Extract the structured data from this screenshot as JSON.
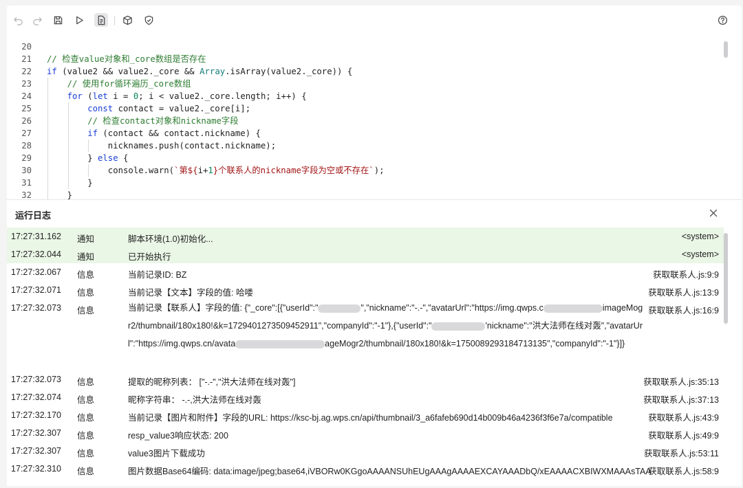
{
  "toolbar": {
    "items": [
      {
        "icon": "undo-icon"
      },
      {
        "icon": "redo-icon"
      },
      {
        "icon": "save-icon"
      },
      {
        "icon": "run-icon"
      },
      {
        "icon": "document-icon"
      },
      {
        "icon": "package-icon"
      },
      {
        "icon": "shield-check-icon"
      },
      {
        "icon": "help-icon"
      }
    ]
  },
  "editor": {
    "lines": [
      {
        "n": "20",
        "indent": 0,
        "tokens": []
      },
      {
        "n": "21",
        "indent": 0,
        "tokens": [
          {
            "c": "c",
            "t": "// 检查value对象和_core数组是否存在"
          }
        ]
      },
      {
        "n": "22",
        "indent": 0,
        "tokens": [
          {
            "c": "k",
            "t": "if"
          },
          {
            "t": " (value2 && value2._core && "
          },
          {
            "c": "t",
            "t": "Array"
          },
          {
            "t": ".isArray(value2._core)) {"
          }
        ]
      },
      {
        "n": "23",
        "indent": 1,
        "tokens": [
          {
            "c": "c",
            "t": "// 使用for循环遍历_core数组"
          }
        ]
      },
      {
        "n": "24",
        "indent": 1,
        "tokens": [
          {
            "c": "k",
            "t": "for"
          },
          {
            "t": " ("
          },
          {
            "c": "k",
            "t": "let"
          },
          {
            "t": " i = "
          },
          {
            "c": "n",
            "t": "0"
          },
          {
            "t": "; i < value2._core.length; i++) {"
          }
        ]
      },
      {
        "n": "25",
        "indent": 2,
        "tokens": [
          {
            "c": "k",
            "t": "const"
          },
          {
            "t": " contact = value2._core[i];"
          }
        ]
      },
      {
        "n": "26",
        "indent": 2,
        "tokens": [
          {
            "c": "c",
            "t": "// 检查contact对象和nickname字段"
          }
        ]
      },
      {
        "n": "27",
        "indent": 2,
        "tokens": [
          {
            "c": "k",
            "t": "if"
          },
          {
            "t": " (contact && contact.nickname) {"
          }
        ]
      },
      {
        "n": "28",
        "indent": 3,
        "tokens": [
          {
            "t": "nicknames.push(contact.nickname);"
          }
        ]
      },
      {
        "n": "29",
        "indent": 2,
        "tokens": [
          {
            "t": "} "
          },
          {
            "c": "k",
            "t": "else"
          },
          {
            "t": " {"
          }
        ]
      },
      {
        "n": "30",
        "indent": 3,
        "tokens": [
          {
            "t": "console.warn("
          },
          {
            "c": "s",
            "t": "`第${"
          },
          {
            "t": "i+"
          },
          {
            "c": "n",
            "t": "1"
          },
          {
            "c": "s",
            "t": "}个联系人的nickname字段为空或不存在`"
          },
          {
            "t": ");"
          }
        ]
      },
      {
        "n": "31",
        "indent": 2,
        "tokens": [
          {
            "t": "}"
          }
        ]
      },
      {
        "n": "32",
        "indent": 1,
        "tokens": [
          {
            "t": "}"
          }
        ]
      }
    ]
  },
  "log": {
    "title": "运行日志",
    "rows": [
      {
        "time": "17:27:31.162",
        "level": "通知",
        "msg": "脚本环境(1.0)初始化...",
        "src": "<system>",
        "hl": true
      },
      {
        "time": "17:27:32.044",
        "level": "通知",
        "msg": "已开始执行",
        "src": "<system>",
        "hl": true
      },
      {
        "time": "17:27:32.067",
        "level": "信息",
        "msg": "当前记录ID: BZ",
        "src": "获取联系人.js:9:9"
      },
      {
        "time": "17:27:32.071",
        "level": "信息",
        "msg": "当前记录【文本】字段的值: 哈喽",
        "src": "获取联系人.js:13:9"
      },
      {
        "time": "17:27:32.073",
        "level": "信息",
        "wrap": true,
        "src": "获取联系人.js:16:9",
        "parts": [
          "当前记录【联系人】字段的值: {\"_core\":[{\"userId\":\"",
          "\",\"nickname\":\"-.-\",\"avatarUrl\":\"https://img.qwps.c",
          "imageMogr2/thumbnail/180x180!&k=1729401273509452911\",\"companyId\":\"-1\"},{\"userId\":\"",
          "'nickname\":\"洪大法师在线对轰\",\"avatarUrl\":\"https://img.qwps.cn/avata",
          "ageMogr2/thumbnail/180x180!&k=1750089293184713135\",\"companyId\":\"-1\"}]}"
        ]
      },
      {
        "time": "17:27:32.073",
        "level": "信息",
        "msg": "提取的昵称列表：  [\"-.-\",\"洪大法师在线对轰\"]",
        "src": "获取联系人.js:35:13"
      },
      {
        "time": "17:27:32.074",
        "level": "信息",
        "msg": "昵称字符串：  -.-,洪大法师在线对轰",
        "src": "获取联系人.js:37:13"
      },
      {
        "time": "17:27:32.170",
        "level": "信息",
        "msg": "当前记录【图片和附件】字段的URL: https://ksc-bj.ag.wps.cn/api/thumbnail/3_a6fafeb690d14b009b46a4236f3f6e7a/compatible",
        "src": "获取联系人.js:43:9"
      },
      {
        "time": "17:27:32.307",
        "level": "信息",
        "msg": "resp_value3响应状态: 200",
        "src": "获取联系人.js:49:9"
      },
      {
        "time": "17:27:32.307",
        "level": "信息",
        "msg": "value3图片下载成功",
        "src": "获取联系人.js:53:11"
      },
      {
        "time": "17:27:32.310",
        "level": "信息",
        "msg": "图片数据Base64编码: data:image/jpeg;base64,iVBORw0KGgoAAAANSUhEUgAAAgAAAAEXCAYAAADbQ/xEAAAACXBIWXMAAAsTAA",
        "src": "获取联系人.js:58:9"
      }
    ]
  }
}
